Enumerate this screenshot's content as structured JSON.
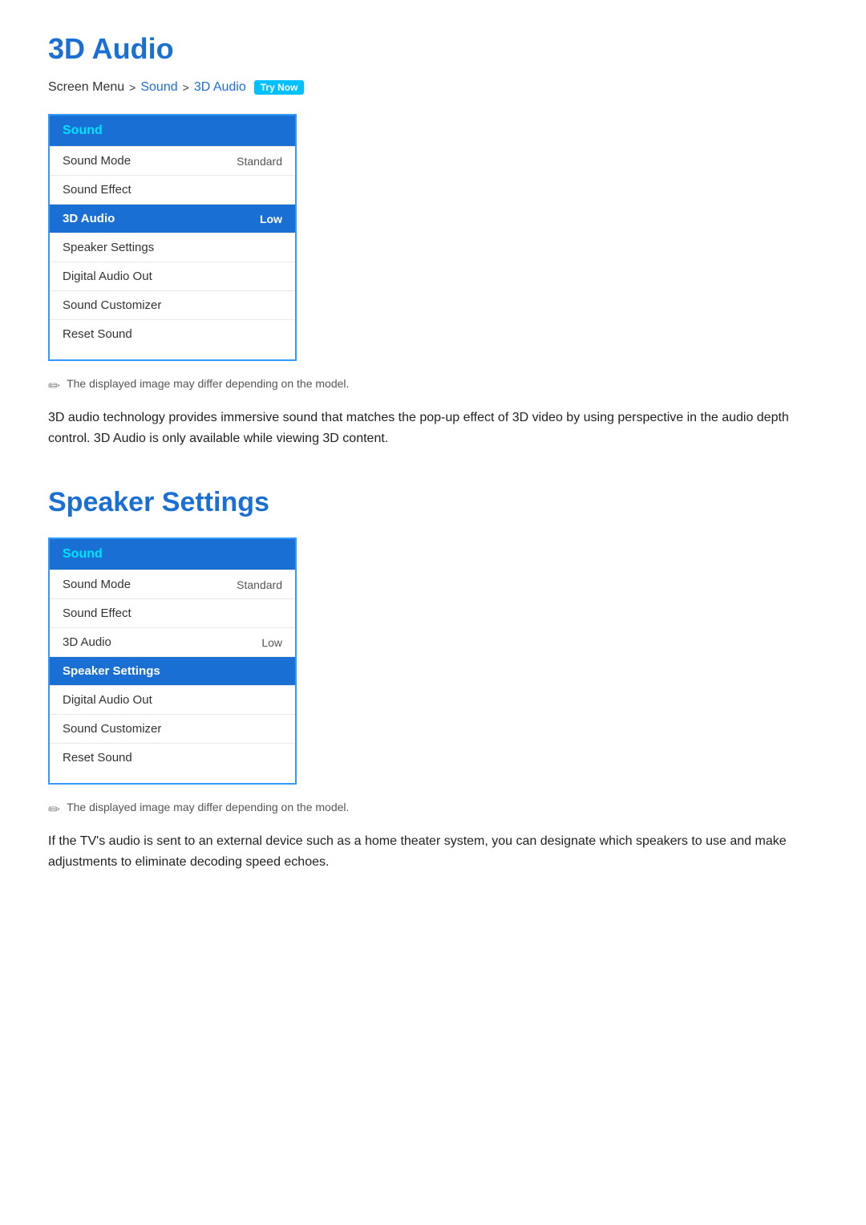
{
  "page": {
    "title": "3D Audio",
    "breadcrumb": {
      "screen_menu": "Screen Menu",
      "sep1": ">",
      "sound": "Sound",
      "sep2": ">",
      "current": "3D Audio",
      "try_now_label": "Try Now"
    },
    "section1": {
      "note": "The displayed image may differ depending on the model.",
      "description": "3D audio technology provides immersive sound that matches the pop-up effect of 3D video by using perspective in the audio depth control. 3D Audio is only available while viewing 3D content."
    },
    "menu1": {
      "header": "Sound",
      "items": [
        {
          "label": "Sound Mode",
          "value": "Standard",
          "highlighted": false
        },
        {
          "label": "Sound Effect",
          "value": "",
          "highlighted": false
        },
        {
          "label": "3D Audio",
          "value": "Low",
          "highlighted": true
        },
        {
          "label": "Speaker Settings",
          "value": "",
          "highlighted": false
        },
        {
          "label": "Digital Audio Out",
          "value": "",
          "highlighted": false
        },
        {
          "label": "Sound Customizer",
          "value": "",
          "highlighted": false
        },
        {
          "label": "Reset Sound",
          "value": "",
          "highlighted": false
        }
      ]
    },
    "section2_title": "Speaker Settings",
    "menu2": {
      "header": "Sound",
      "items": [
        {
          "label": "Sound Mode",
          "value": "Standard",
          "highlighted": false
        },
        {
          "label": "Sound Effect",
          "value": "",
          "highlighted": false
        },
        {
          "label": "3D Audio",
          "value": "Low",
          "highlighted": false
        },
        {
          "label": "Speaker Settings",
          "value": "",
          "highlighted": true
        },
        {
          "label": "Digital Audio Out",
          "value": "",
          "highlighted": false
        },
        {
          "label": "Sound Customizer",
          "value": "",
          "highlighted": false
        },
        {
          "label": "Reset Sound",
          "value": "",
          "highlighted": false
        }
      ]
    },
    "section2": {
      "note": "The displayed image may differ depending on the model.",
      "description": "If the TV's audio is sent to an external device such as a home theater system, you can designate which speakers to use and make adjustments to eliminate decoding speed echoes."
    }
  }
}
